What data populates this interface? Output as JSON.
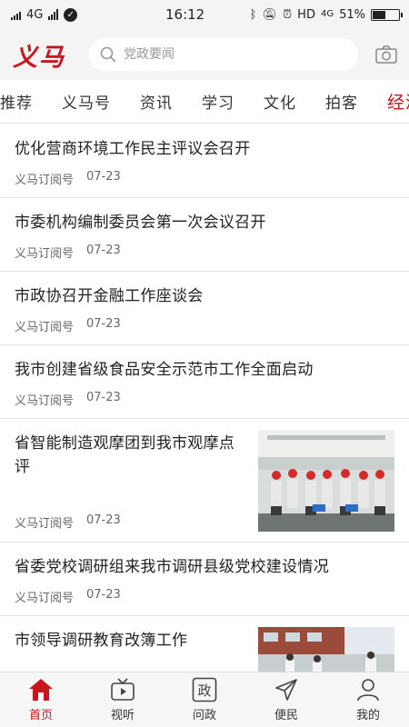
{
  "status_bar": {
    "network": "4G",
    "time": "16:12",
    "hd": "HD",
    "network_right": "4G",
    "battery": "51%",
    "battery_level": 0.51
  },
  "header": {
    "logo": "义马",
    "search_placeholder": "党政要闻"
  },
  "tabs": [
    "推荐",
    "义马号",
    "资讯",
    "学习",
    "文化",
    "拍客",
    "经济"
  ],
  "active_tab_index": 6,
  "news": [
    {
      "title": "优化营商环境工作民主评议会召开",
      "source": "义马订阅号",
      "date": "07-23"
    },
    {
      "title": "市委机构编制委员会第一次会议召开",
      "source": "义马订阅号",
      "date": "07-23"
    },
    {
      "title": "市政协召开金融工作座谈会",
      "source": "义马订阅号",
      "date": "07-23"
    },
    {
      "title": "我市创建省级食品安全示范市工作全面启动",
      "source": "义马订阅号",
      "date": "07-23"
    },
    {
      "title": "省智能制造观摩团到我市观摩点评",
      "source": "义马订阅号",
      "date": "07-23"
    },
    {
      "title": "省委党校调研组来我市调研县级党校建设情况",
      "source": "义马订阅号",
      "date": "07-23"
    },
    {
      "title": "市领导调研教育改簿工作"
    }
  ],
  "bottom_nav": [
    {
      "label": "首页",
      "icon": "home-icon"
    },
    {
      "label": "视听",
      "icon": "tv-icon"
    },
    {
      "label": "问政",
      "icon": "zheng-icon"
    },
    {
      "label": "便民",
      "icon": "send-icon"
    },
    {
      "label": "我的",
      "icon": "user-icon"
    }
  ],
  "colors": {
    "accent": "#c9151e"
  }
}
